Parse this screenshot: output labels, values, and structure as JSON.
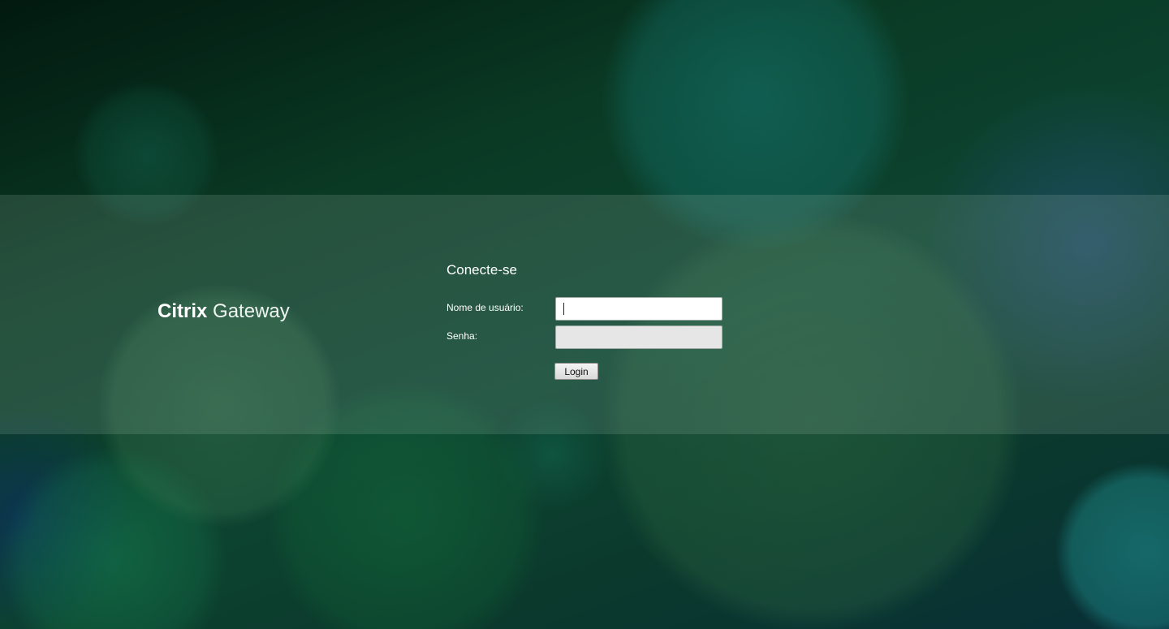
{
  "brand": {
    "name_bold": "Citrix",
    "name_light": "Gateway"
  },
  "login": {
    "title": "Conecte-se",
    "username_label": "Nome de usuário:",
    "username_value": "",
    "password_label": "Senha:",
    "password_value": "",
    "submit_label": "Login"
  },
  "colors": {
    "background_dark": "#0a3a24",
    "band_overlay": "#afc8be",
    "text": "#ffffff",
    "password_field": "#e6e6e6"
  }
}
